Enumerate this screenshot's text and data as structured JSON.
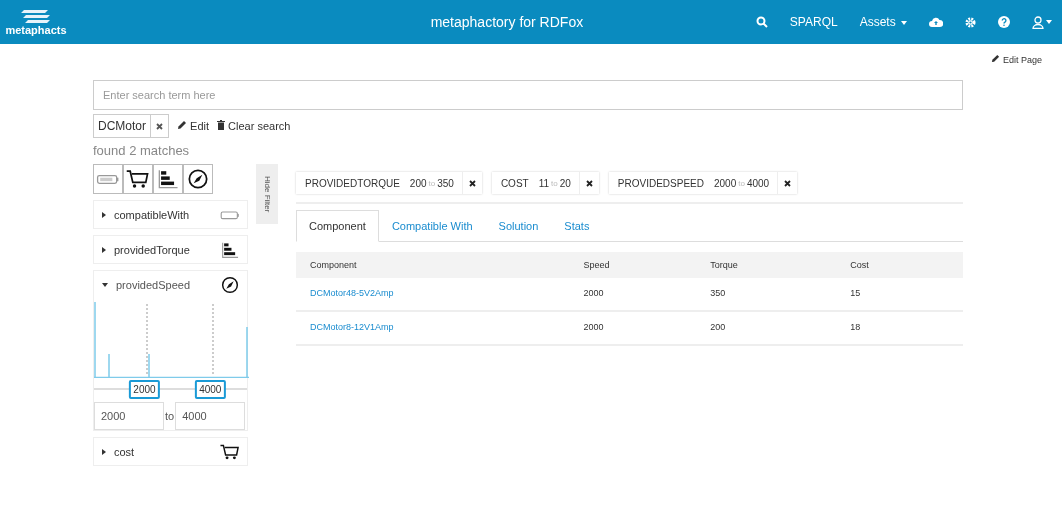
{
  "navbar": {
    "logo_text": "metaphacts",
    "title": "metaphactory for RDFox",
    "items": [
      {
        "kind": "search"
      },
      {
        "kind": "text",
        "label": "SPARQL"
      },
      {
        "kind": "dropdown",
        "label": "Assets"
      },
      {
        "kind": "cloud"
      },
      {
        "kind": "gear"
      },
      {
        "kind": "help"
      },
      {
        "kind": "user"
      }
    ]
  },
  "edit_page": "Edit Page",
  "search": {
    "placeholder": "Enter search term here"
  },
  "query": {
    "term": "DCMotor",
    "edit": "Edit",
    "clear": "Clear search"
  },
  "found": "found 2 matches",
  "facet_icons": [
    {
      "kind": "battery"
    },
    {
      "kind": "cart"
    },
    {
      "kind": "bars"
    },
    {
      "kind": "compass"
    }
  ],
  "hide_filter": "Hide Filter",
  "facets": [
    {
      "label": "compatibleWith",
      "kind": "battery",
      "expanded": false
    },
    {
      "label": "providedTorque",
      "kind": "bars",
      "expanded": false
    },
    {
      "label": "providedSpeed",
      "kind": "compass",
      "expanded": true,
      "slider": {
        "thumbs": [
          {
            "label": "2000",
            "level": 0.33
          },
          {
            "label": "4000",
            "level": 0.76
          }
        ]
      },
      "from": "2000",
      "sep": "to",
      "to": "4000"
    },
    {
      "label": "cost",
      "kind": "cart",
      "expanded": false
    }
  ],
  "chips": [
    {
      "name": "PROVIDEDTORQUE",
      "from": "200",
      "sep": "to",
      "to": "350"
    },
    {
      "name": "COST",
      "from": "11",
      "sep": "to",
      "to": "20"
    },
    {
      "name": "PROVIDEDSPEED",
      "from": "2000",
      "sep": "to",
      "to": "4000"
    }
  ],
  "tabs": [
    {
      "label": "Component",
      "selected": true
    },
    {
      "label": "Compatible With",
      "selected": false
    },
    {
      "label": "Solution",
      "selected": false
    },
    {
      "label": "Stats",
      "selected": false
    }
  ],
  "table": {
    "columns": [
      "Component",
      "Speed",
      "Torque",
      "Cost"
    ],
    "rows": [
      [
        "DCMotor48-5V2Amp",
        "2000",
        "350",
        "15"
      ],
      [
        "DCMotor8-12V1Amp",
        "2000",
        "200",
        "18"
      ]
    ]
  }
}
